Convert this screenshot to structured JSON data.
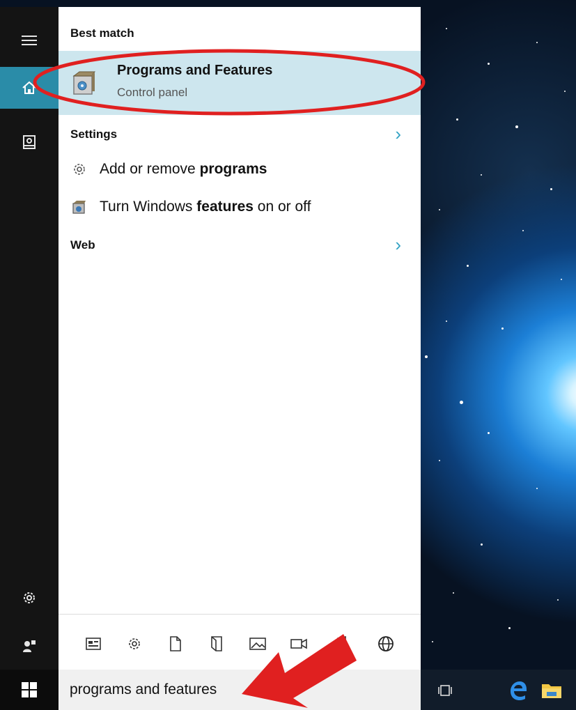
{
  "panel": {
    "best_match_header": "Best match",
    "best_match": {
      "title": "Programs and Features",
      "subtitle": "Control panel"
    },
    "settings_header": "Settings",
    "settings_chevron": "›",
    "settings_results": [
      {
        "prefix": "Add or remove ",
        "bold": "programs",
        "suffix": ""
      },
      {
        "prefix": "Turn Windows ",
        "bold": "features",
        "suffix": " on or off"
      }
    ],
    "web_header": "Web",
    "web_chevron": "›"
  },
  "sidebar": {
    "items": [
      {
        "icon": "hamburger-menu-icon"
      },
      {
        "icon": "home-icon",
        "active": true
      },
      {
        "icon": "notebook-icon"
      },
      {
        "icon": "settings-gear-icon"
      },
      {
        "icon": "feedback-icon"
      }
    ]
  },
  "filter_bar": {
    "icons": [
      "apps-icon",
      "settings-icon",
      "documents-icon",
      "folders-icon",
      "photos-icon",
      "videos-icon",
      "music-icon",
      "web-icon"
    ]
  },
  "search": {
    "value": "programs and features"
  },
  "taskbar": {
    "icons": [
      "start-icon",
      "task-view-icon",
      "edge-browser-icon",
      "file-explorer-icon"
    ]
  },
  "annotations": {
    "highlight_color": "#e02020",
    "arrow_color": "#e02020"
  },
  "colors": {
    "accent": "#34a3c4",
    "selection": "#cde6ee",
    "sidebar": "#141414"
  }
}
